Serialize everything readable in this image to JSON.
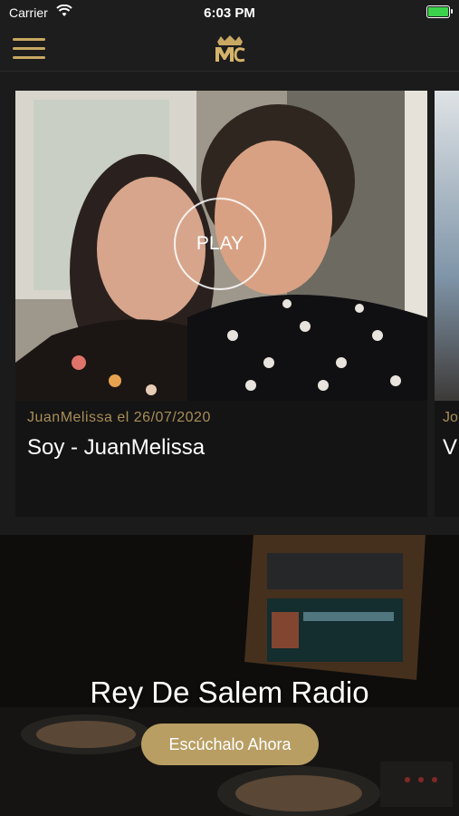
{
  "status_bar": {
    "carrier": "Carrier",
    "time": "6:03 PM",
    "wifi_icon": "wifi-icon",
    "battery_icon": "battery-charging-icon",
    "battery_color": "#3cd24b"
  },
  "nav": {
    "menu_icon": "hamburger-menu-icon",
    "logo_icon": "mc-crown-logo",
    "accent_color": "#c8a862"
  },
  "carousel": {
    "cards": [
      {
        "meta": "JuanMelissa el 26/07/2020",
        "title": "Soy - JuanMelissa",
        "play_label": "PLAY"
      },
      {
        "meta": "Jo",
        "title": "V"
      }
    ]
  },
  "radio": {
    "title": "Rey De Salem Radio",
    "button_label": "Escúchalo Ahora",
    "button_color": "#b89e63"
  }
}
